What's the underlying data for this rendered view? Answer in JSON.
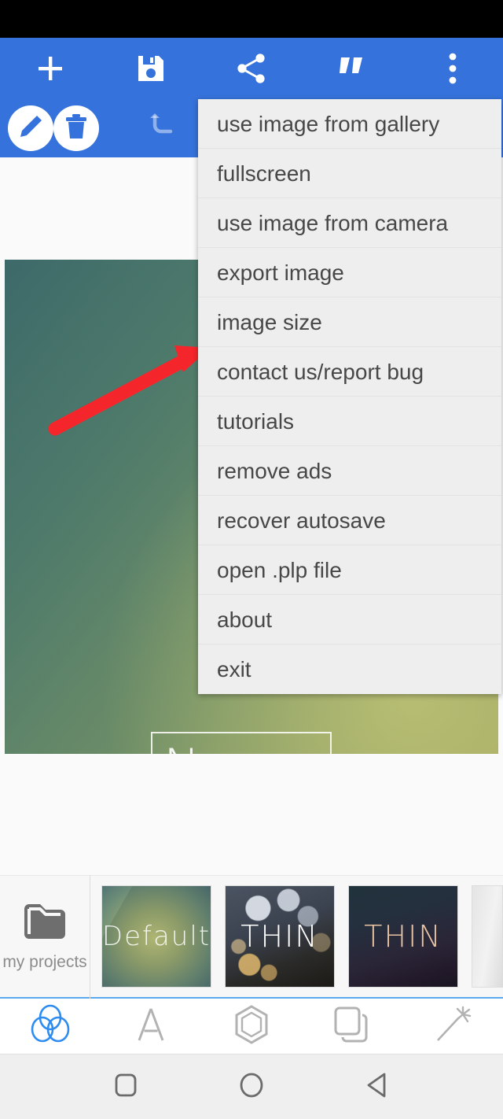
{
  "app": {
    "name": "photo-editor",
    "accent_blue": "#3572DB",
    "menu_bg": "#EEEEEE",
    "menu_text_color": "#474747"
  },
  "statusbar": {
    "background": "#000000"
  },
  "toolbar": {
    "primary_actions": [
      {
        "name": "add",
        "icon": "plus-icon",
        "label": "+"
      },
      {
        "name": "save",
        "icon": "save-icon",
        "label": "save"
      },
      {
        "name": "share",
        "icon": "share-icon",
        "label": "share"
      },
      {
        "name": "quote",
        "icon": "quote-icon",
        "label": "”"
      },
      {
        "name": "overflow",
        "icon": "more-vertical-icon",
        "label": "more"
      }
    ],
    "secondary_actions": [
      {
        "name": "edit",
        "icon": "pencil-icon",
        "label": "edit"
      },
      {
        "name": "delete",
        "icon": "trash-icon",
        "label": "delete"
      },
      {
        "name": "undo",
        "icon": "undo-icon",
        "label": "undo",
        "disabled": true
      }
    ]
  },
  "menu": {
    "open": true,
    "items": [
      {
        "label": "use image from gallery"
      },
      {
        "label": "fullscreen"
      },
      {
        "label": "use image from camera"
      },
      {
        "label": "export image"
      },
      {
        "label": "image size"
      },
      {
        "label": "contact us/report bug"
      },
      {
        "label": "tutorials"
      },
      {
        "label": "remove ads"
      },
      {
        "label": "recover autosave"
      },
      {
        "label": "open .plp file"
      },
      {
        "label": "about"
      },
      {
        "label": "exit"
      }
    ]
  },
  "canvas": {
    "text_layer": {
      "text": "Ne",
      "selected": true
    },
    "annotation": {
      "type": "arrow",
      "color": "#F5262B",
      "points_to": "image size"
    }
  },
  "templates": {
    "my_projects_label": "my projects",
    "items": [
      {
        "label": "Default",
        "style": "green-gradient"
      },
      {
        "label": "THIN",
        "style": "bokeh"
      },
      {
        "label": "THIN",
        "style": "dark-gradient"
      },
      {
        "label": "",
        "style": "partial"
      }
    ]
  },
  "tooltabs": {
    "items": [
      {
        "name": "filters",
        "icon": "three-circles-icon",
        "active": true
      },
      {
        "name": "text",
        "icon": "letter-a-icon",
        "active": false
      },
      {
        "name": "shapes",
        "icon": "hexagon-icon",
        "active": false
      },
      {
        "name": "layers",
        "icon": "layers-icon",
        "active": false
      },
      {
        "name": "effects",
        "icon": "magic-wand-icon",
        "active": false
      }
    ],
    "active_color": "#2E8CF0",
    "inactive_color": "#b2b2b2"
  },
  "navbar": {
    "buttons": [
      {
        "name": "recents",
        "icon": "square-icon"
      },
      {
        "name": "home",
        "icon": "circle-icon"
      },
      {
        "name": "back",
        "icon": "triangle-left-icon"
      }
    ]
  }
}
